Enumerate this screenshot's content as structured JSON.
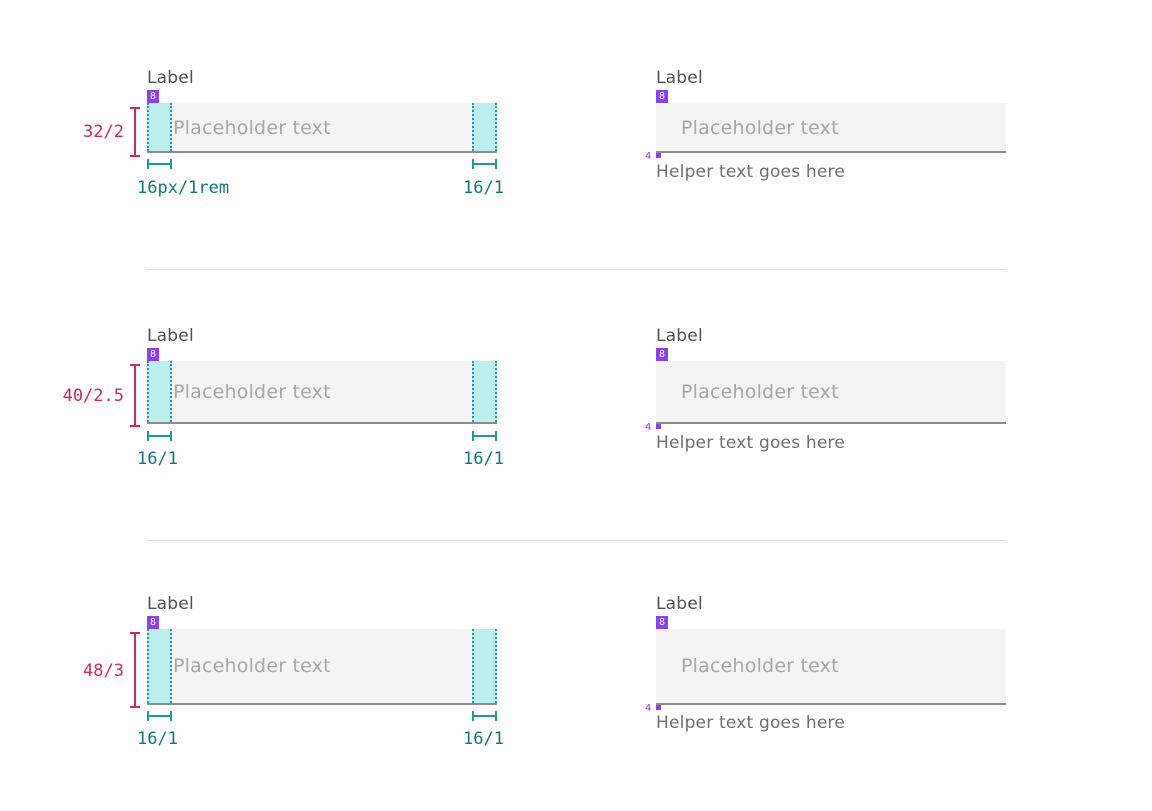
{
  "rows": [
    {
      "size": "small",
      "height_label": "32/2",
      "left": {
        "label": "Label",
        "spacing_badge": "8",
        "placeholder": "Placeholder text",
        "left_padding_label": "16px/1rem",
        "right_padding_label": "16/1"
      },
      "right": {
        "label": "Label",
        "spacing_badge": "8",
        "placeholder": "Placeholder text",
        "helper_spacing": "4",
        "helper_text": "Helper text goes here"
      }
    },
    {
      "size": "medium",
      "height_label": "40/2.5",
      "left": {
        "label": "Label",
        "spacing_badge": "8",
        "placeholder": "Placeholder text",
        "left_padding_label": "16/1",
        "right_padding_label": "16/1"
      },
      "right": {
        "label": "Label",
        "spacing_badge": "8",
        "placeholder": "Placeholder text",
        "helper_spacing": "4",
        "helper_text": "Helper text goes here"
      }
    },
    {
      "size": "large",
      "height_label": "48/3",
      "left": {
        "label": "Label",
        "spacing_badge": "8",
        "placeholder": "Placeholder text",
        "left_padding_label": "16/1",
        "right_padding_label": "16/1"
      },
      "right": {
        "label": "Label",
        "spacing_badge": "8",
        "placeholder": "Placeholder text",
        "helper_spacing": "4",
        "helper_text": "Helper text goes here"
      }
    }
  ],
  "colors": {
    "spacing_badge": "#8a3ffc",
    "height_measure": "#d12765",
    "padding_measure": "#1d9a9c",
    "padding_fill": "#bdeff0",
    "field_background": "#f4f4f4",
    "field_border": "#8d8d8d"
  }
}
